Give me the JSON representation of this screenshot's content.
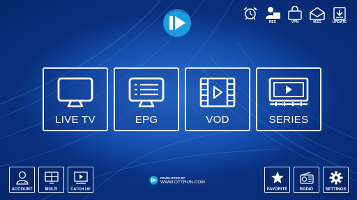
{
  "brand": {
    "name": "OTTRUN"
  },
  "top_icons": [
    {
      "name": "alarm-icon",
      "label": ""
    },
    {
      "name": "rec-icon",
      "label": "REC"
    },
    {
      "name": "vpn-icon",
      "label": "VPN"
    },
    {
      "name": "message-icon",
      "label": "MSG"
    },
    {
      "name": "update-icon",
      "label": "UPDATE"
    }
  ],
  "tiles": [
    {
      "name": "live-tv",
      "label": "LIVE TV"
    },
    {
      "name": "epg",
      "label": "EPG"
    },
    {
      "name": "vod",
      "label": "VOD"
    },
    {
      "name": "series",
      "label": "SERIES"
    }
  ],
  "bottom_left": [
    {
      "name": "account",
      "label": "ACCOUNT"
    },
    {
      "name": "multi",
      "label": "MULTI"
    },
    {
      "name": "catch-up",
      "label": "CATCH UP"
    }
  ],
  "bottom_right": [
    {
      "name": "favorite",
      "label": "FAVORITE"
    },
    {
      "name": "radio",
      "label": "RADIO"
    },
    {
      "name": "settings",
      "label": "SETTINGS"
    }
  ],
  "developer": {
    "caption": "DEVELOPED BY",
    "url": "WWW.OTTRUN.COM"
  },
  "colors": {
    "accent": "#1e9be0",
    "border": "#e8eefb"
  }
}
